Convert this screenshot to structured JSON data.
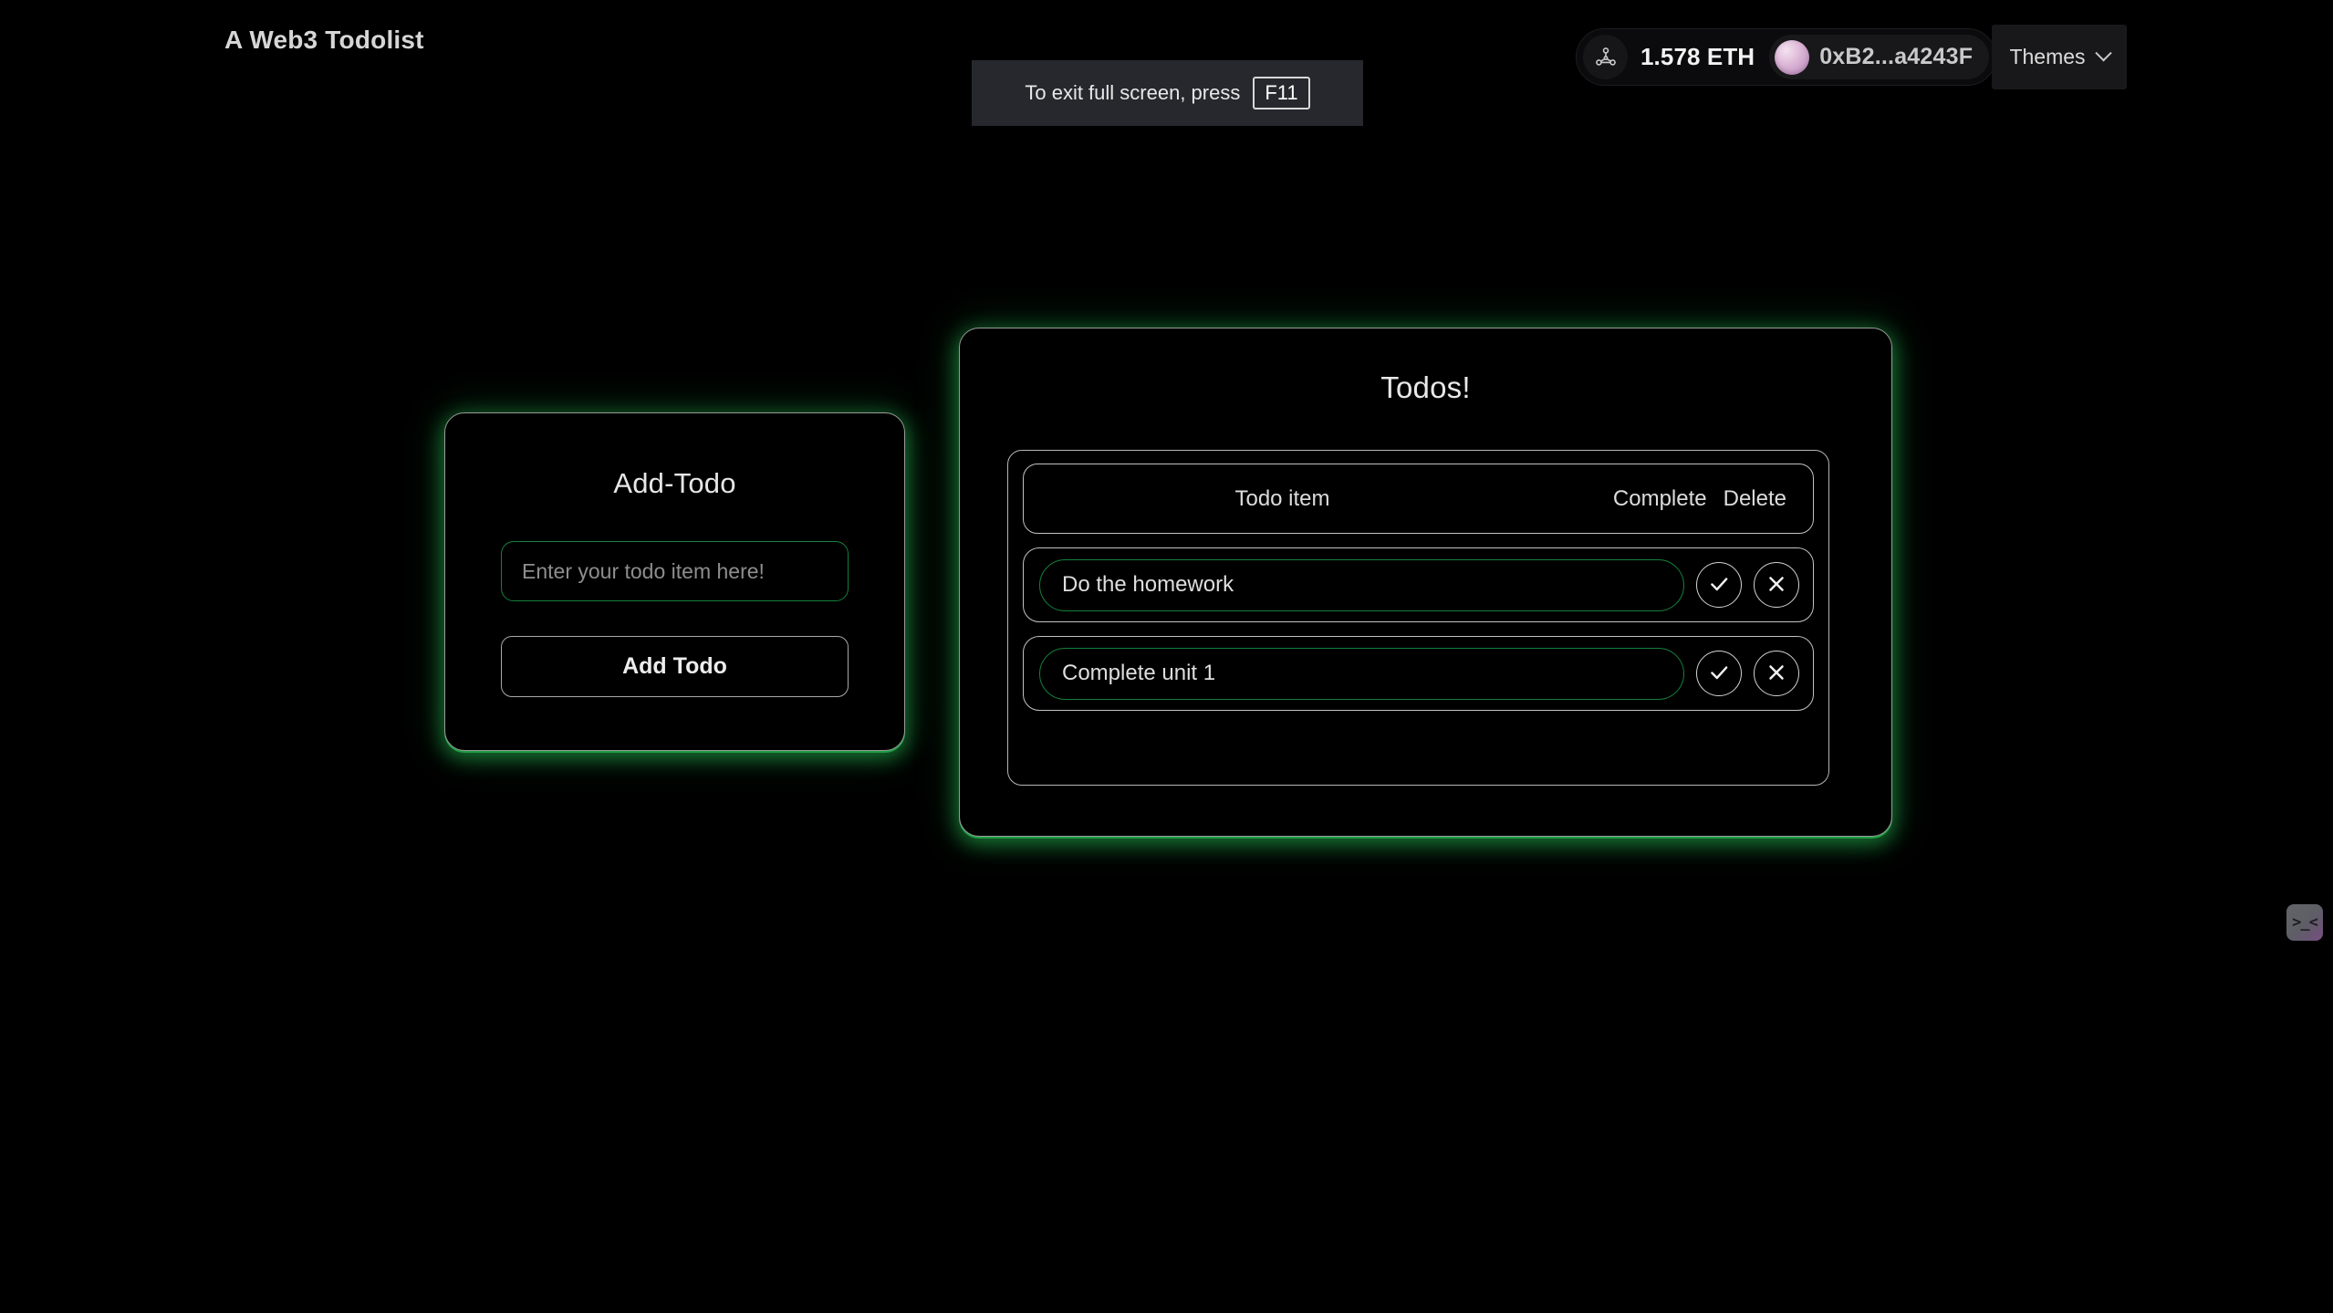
{
  "app": {
    "title": "A Web3 Todolist",
    "background_color": "#000000",
    "accent_color": "#15803d",
    "glow_color": "#1f9d45"
  },
  "toast": {
    "message": "To exit full screen, press",
    "key_label": "F11"
  },
  "wallet": {
    "network_icon": "network-nodes-icon",
    "balance": "1.578 ETH",
    "address": "0xB2...a4243F",
    "avatar_icon": "wallet-avatar"
  },
  "themes_button": {
    "label": "Themes",
    "chevron_icon": "chevron-down-icon"
  },
  "add_todo_card": {
    "title": "Add-Todo",
    "input_placeholder": "Enter your todo item here!",
    "input_value": "",
    "submit_label": "Add Todo"
  },
  "todos_card": {
    "title": "Todos!",
    "columns": {
      "item": "Todo item",
      "complete": "Complete",
      "delete": "Delete"
    },
    "rows": [
      {
        "text": "Do the homework",
        "complete_icon": "check-icon",
        "delete_icon": "close-icon"
      },
      {
        "text": "Complete unit 1",
        "complete_icon": "check-icon",
        "delete_icon": "close-icon"
      }
    ]
  },
  "corner_widget": {
    "face": ">_<"
  }
}
